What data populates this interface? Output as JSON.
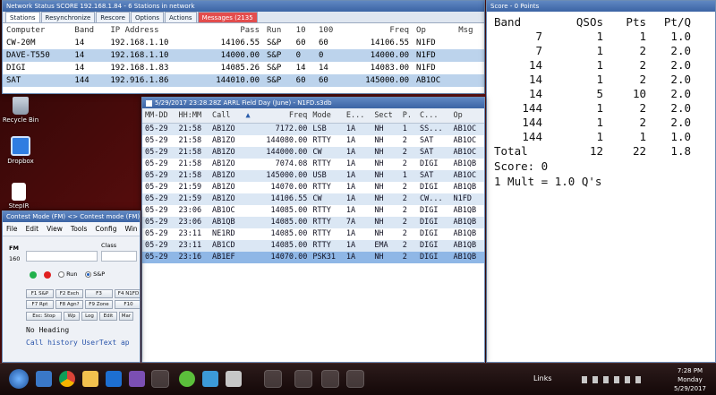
{
  "desktop": {
    "icons": [
      {
        "label": "Recycle Bin"
      },
      {
        "label": "Dropbox"
      },
      {
        "label": "StepIR"
      }
    ]
  },
  "network_window": {
    "title": "Network Status SCORE 192.168.1.84 - 6 Stations in network",
    "tabs": [
      "Stations",
      "Resynchronize",
      "Rescore",
      "Options",
      "Actions",
      "Messages (2135"
    ],
    "columns": [
      "Computer",
      "Band",
      "IP Address",
      "Pass",
      "Run",
      "10",
      "100",
      "Freq",
      "Op",
      "Msg"
    ],
    "rows": [
      [
        "CW-20M",
        "14",
        "192.168.1.10",
        "14106.55",
        "S&P",
        "60",
        "60",
        "14106.55",
        "N1FD",
        ""
      ],
      [
        "DAVE-T550",
        "14",
        "192.168.1.10",
        "14000.00",
        "S&P",
        "0",
        "0",
        "14000.00",
        "N1FD",
        ""
      ],
      [
        "DIGI",
        "14",
        "192.168.1.83",
        "14085.26",
        "S&P",
        "14",
        "14",
        "14083.00",
        "N1FD",
        ""
      ],
      [
        "SAT",
        "144",
        "192.916.1.86",
        "144010.00",
        "S&P",
        "60",
        "60",
        "145000.00",
        "AB1OC",
        ""
      ]
    ]
  },
  "score_window": {
    "title": "Score - 0 Points",
    "headers": [
      "Band",
      "QSOs",
      "Pts",
      "Pt/Q"
    ],
    "rows": [
      [
        "7",
        "1",
        "1",
        "1.0"
      ],
      [
        "7",
        "1",
        "2",
        "2.0"
      ],
      [
        "14",
        "1",
        "2",
        "2.0"
      ],
      [
        "14",
        "1",
        "2",
        "2.0"
      ],
      [
        "14",
        "5",
        "10",
        "2.0"
      ],
      [
        "144",
        "1",
        "2",
        "2.0"
      ],
      [
        "144",
        "1",
        "2",
        "2.0"
      ],
      [
        "144",
        "1",
        "1",
        "1.0"
      ]
    ],
    "total": [
      "Total",
      "12",
      "22",
      "1.8"
    ],
    "score_line": "Score: 0",
    "mult_line": "1 Mult = 1.0 Q's"
  },
  "log_window": {
    "title": "5/29/2017 23:28.28Z  ARRL Field Day (June) - N1FD.s3db",
    "columns": [
      "MM-DD",
      "HH:MM",
      "Call",
      "▲",
      "Freq",
      "Mode",
      "E...",
      "Sect",
      "P.",
      "C...",
      "Op"
    ],
    "rows": [
      [
        "05-29",
        "21:58",
        "AB1ZO",
        "",
        "7172.00",
        "LSB",
        "1A",
        "NH",
        "1",
        "SS...",
        "AB1OC"
      ],
      [
        "05-29",
        "21:58",
        "AB1ZO",
        "",
        "144080.00",
        "RTTY",
        "1A",
        "NH",
        "2",
        "SAT",
        "AB1OC"
      ],
      [
        "05-29",
        "21:58",
        "AB1ZO",
        "",
        "144000.00",
        "CW",
        "1A",
        "NH",
        "2",
        "SAT",
        "AB1OC"
      ],
      [
        "05-29",
        "21:58",
        "AB1ZO",
        "",
        "7074.08",
        "RTTY",
        "1A",
        "NH",
        "2",
        "DIGI",
        "AB1QB"
      ],
      [
        "05-29",
        "21:58",
        "AB1ZO",
        "",
        "145000.00",
        "USB",
        "1A",
        "NH",
        "1",
        "SAT",
        "AB1OC"
      ],
      [
        "05-29",
        "21:59",
        "AB1ZO",
        "",
        "14070.00",
        "RTTY",
        "1A",
        "NH",
        "2",
        "DIGI",
        "AB1QB"
      ],
      [
        "05-29",
        "21:59",
        "AB1ZO",
        "",
        "14106.55",
        "CW",
        "1A",
        "NH",
        "2",
        "CW...",
        "N1FD"
      ],
      [
        "05-29",
        "23:06",
        "AB1OC",
        "",
        "14085.00",
        "RTTY",
        "1A",
        "NH",
        "2",
        "DIGI",
        "AB1QB"
      ],
      [
        "05-29",
        "23:06",
        "AB1QB",
        "",
        "14085.00",
        "RTTY",
        "7A",
        "NH",
        "2",
        "DIGI",
        "AB1QB"
      ],
      [
        "05-29",
        "23:11",
        "NE1RD",
        "",
        "14085.00",
        "RTTY",
        "1A",
        "NH",
        "2",
        "DIGI",
        "AB1QB"
      ],
      [
        "05-29",
        "23:11",
        "AB1CD",
        "",
        "14085.00",
        "RTTY",
        "1A",
        "EMA",
        "2",
        "DIGI",
        "AB1QB"
      ],
      [
        "05-29",
        "23:16",
        "AB1EF",
        "",
        "14070.00",
        "PSK31",
        "1A",
        "NH",
        "2",
        "DIGI",
        "AB1QB"
      ]
    ],
    "selected_row": 11
  },
  "contest_window": {
    "title": "Contest Mode (FM) <> Contest mode (FM)",
    "menu": [
      "File",
      "Edit",
      "View",
      "Tools",
      "Config",
      "Win"
    ],
    "fm_label": "FM",
    "freq_label": "160",
    "class_label": "Class",
    "run_label": "Run",
    "sp_label": "S&P",
    "fkeys": [
      "F1 S&P",
      "F2 Exch",
      "F3",
      "F4 N1FD",
      "F7 Rpt",
      "F8 Agn?",
      "F9 Zone",
      "F10",
      "Esc: Stop",
      "Wp",
      "Log",
      "Edit",
      "Mar"
    ],
    "heading": "No Heading",
    "history": "Call history UserText ap"
  },
  "taskbar": {
    "links_label": "Links",
    "time": "7:28 PM",
    "day": "Monday",
    "date": "5/29/2017"
  },
  "colors": {
    "titlebar": "#3b64a4",
    "selection": "#8fb7e6",
    "alert_tab": "#e34d4d",
    "led_green": "#22b14c",
    "led_red": "#e02020"
  }
}
